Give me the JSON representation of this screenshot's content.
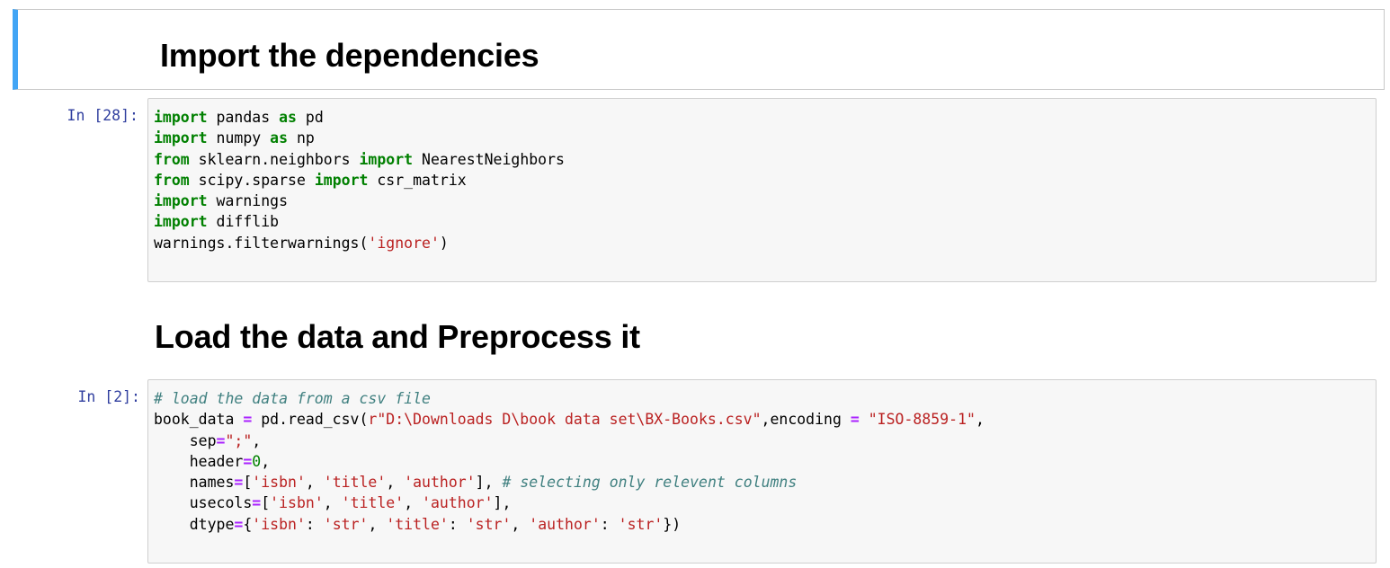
{
  "cells": {
    "md1": {
      "heading": "Import the dependencies"
    },
    "code1": {
      "prompt": "In [28]:",
      "lines": [
        [
          {
            "t": "import",
            "c": "kw"
          },
          {
            "t": " pandas "
          },
          {
            "t": "as",
            "c": "kw"
          },
          {
            "t": " pd"
          }
        ],
        [
          {
            "t": "import",
            "c": "kw"
          },
          {
            "t": " numpy "
          },
          {
            "t": "as",
            "c": "kw"
          },
          {
            "t": " np"
          }
        ],
        [
          {
            "t": "from",
            "c": "kw"
          },
          {
            "t": " sklearn.neighbors "
          },
          {
            "t": "import",
            "c": "kw"
          },
          {
            "t": " NearestNeighbors"
          }
        ],
        [
          {
            "t": "from",
            "c": "kw"
          },
          {
            "t": " scipy.sparse "
          },
          {
            "t": "import",
            "c": "kw"
          },
          {
            "t": " csr_matrix"
          }
        ],
        [
          {
            "t": "import",
            "c": "kw"
          },
          {
            "t": " warnings"
          }
        ],
        [
          {
            "t": "import",
            "c": "kw"
          },
          {
            "t": " difflib"
          }
        ],
        [
          {
            "t": "warnings.filterwarnings("
          },
          {
            "t": "'ignore'",
            "c": "str"
          },
          {
            "t": ")"
          }
        ]
      ]
    },
    "md2": {
      "heading": "Load the data and Preprocess it"
    },
    "code2": {
      "prompt": "In [2]:",
      "lines": [
        [
          {
            "t": "# load the data from a csv file",
            "c": "cm"
          }
        ],
        [
          {
            "t": "book_data "
          },
          {
            "t": "=",
            "c": "op"
          },
          {
            "t": " pd.read_csv("
          },
          {
            "t": "r\"D:\\Downloads D\\book data set\\BX-Books.csv\"",
            "c": "str"
          },
          {
            "t": ",encoding "
          },
          {
            "t": "=",
            "c": "op"
          },
          {
            "t": " "
          },
          {
            "t": "\"ISO-8859-1\"",
            "c": "str"
          },
          {
            "t": ","
          }
        ],
        [
          {
            "t": "    sep"
          },
          {
            "t": "=",
            "c": "op"
          },
          {
            "t": "\";\"",
            "c": "str"
          },
          {
            "t": ","
          }
        ],
        [
          {
            "t": "    header"
          },
          {
            "t": "=",
            "c": "op"
          },
          {
            "t": "0",
            "c": "num"
          },
          {
            "t": ","
          }
        ],
        [
          {
            "t": "    names"
          },
          {
            "t": "=",
            "c": "op"
          },
          {
            "t": "["
          },
          {
            "t": "'isbn'",
            "c": "str"
          },
          {
            "t": ", "
          },
          {
            "t": "'title'",
            "c": "str"
          },
          {
            "t": ", "
          },
          {
            "t": "'author'",
            "c": "str"
          },
          {
            "t": "], "
          },
          {
            "t": "# selecting only relevent columns",
            "c": "cm"
          }
        ],
        [
          {
            "t": "    usecols"
          },
          {
            "t": "=",
            "c": "op"
          },
          {
            "t": "["
          },
          {
            "t": "'isbn'",
            "c": "str"
          },
          {
            "t": ", "
          },
          {
            "t": "'title'",
            "c": "str"
          },
          {
            "t": ", "
          },
          {
            "t": "'author'",
            "c": "str"
          },
          {
            "t": "],"
          }
        ],
        [
          {
            "t": "    dtype"
          },
          {
            "t": "=",
            "c": "op"
          },
          {
            "t": "{"
          },
          {
            "t": "'isbn'",
            "c": "str"
          },
          {
            "t": ": "
          },
          {
            "t": "'str'",
            "c": "str"
          },
          {
            "t": ", "
          },
          {
            "t": "'title'",
            "c": "str"
          },
          {
            "t": ": "
          },
          {
            "t": "'str'",
            "c": "str"
          },
          {
            "t": ", "
          },
          {
            "t": "'author'",
            "c": "str"
          },
          {
            "t": ": "
          },
          {
            "t": "'str'",
            "c": "str"
          },
          {
            "t": "})"
          }
        ]
      ]
    }
  }
}
